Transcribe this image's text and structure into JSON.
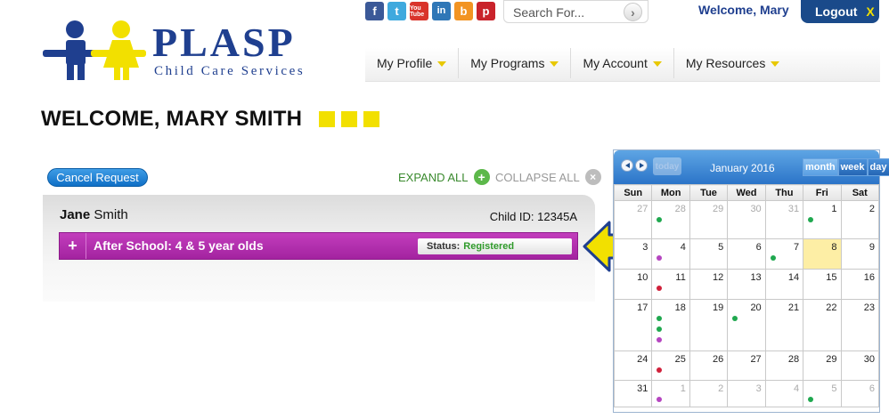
{
  "brand": {
    "name": "PLASP",
    "tagline": "Child Care Services",
    "colors": {
      "navy": "#1f3f8f",
      "yellow": "#f2e000",
      "magenta": "#b02fad"
    }
  },
  "social": [
    {
      "icon": "facebook-icon",
      "glyph": "f"
    },
    {
      "icon": "twitter-icon",
      "glyph": "t"
    },
    {
      "icon": "youtube-icon",
      "glyph": "You Tube"
    },
    {
      "icon": "linkedin-icon",
      "glyph": "in"
    },
    {
      "icon": "blogger-icon",
      "glyph": "b"
    },
    {
      "icon": "pinterest-icon",
      "glyph": "p"
    }
  ],
  "search": {
    "placeholder": "Search For...",
    "button_glyph": "›"
  },
  "user": {
    "welcome": "Welcome, Mary",
    "logout_label": "Logout",
    "logout_x": "X"
  },
  "nav": [
    {
      "id": "my-profile",
      "label": "My Profile"
    },
    {
      "id": "my-programs",
      "label": "My Programs"
    },
    {
      "id": "my-account",
      "label": "My Account"
    },
    {
      "id": "my-resources",
      "label": "My Resources"
    }
  ],
  "page": {
    "title": "WELCOME, MARY SMITH"
  },
  "request": {
    "cancel_label": "Cancel Request",
    "expand_label": "EXPAND ALL",
    "expand_glyph": "+",
    "collapse_label": "COLLAPSE ALL",
    "collapse_glyph": "×",
    "child": {
      "first_name": "Jane",
      "last_name": "Smith",
      "id_label": "Child ID:",
      "id_value": "12345A"
    },
    "program": {
      "plus_glyph": "+",
      "name": "After School: 4 & 5 year olds",
      "status_label": "Status:",
      "status_value": "Registered"
    }
  },
  "calendar": {
    "title": "January 2016",
    "today_label": "today",
    "views": [
      "month",
      "week",
      "day"
    ],
    "active_view": "month",
    "weekdays": [
      "Sun",
      "Mon",
      "Tue",
      "Wed",
      "Thu",
      "Fri",
      "Sat"
    ],
    "dot_colors": {
      "g": "#1fa84f",
      "p": "#b545c0",
      "r": "#d0203a"
    },
    "weeks": [
      [
        {
          "d": "27",
          "other": true
        },
        {
          "d": "28",
          "other": true,
          "dots": [
            "g"
          ]
        },
        {
          "d": "29",
          "other": true
        },
        {
          "d": "30",
          "other": true
        },
        {
          "d": "31",
          "other": true
        },
        {
          "d": "1",
          "dots": [
            "g"
          ]
        },
        {
          "d": "2"
        }
      ],
      [
        {
          "d": "3"
        },
        {
          "d": "4",
          "dots": [
            "p"
          ]
        },
        {
          "d": "5"
        },
        {
          "d": "6"
        },
        {
          "d": "7",
          "dots": [
            "g"
          ]
        },
        {
          "d": "8",
          "today": true
        },
        {
          "d": "9"
        }
      ],
      [
        {
          "d": "10"
        },
        {
          "d": "11",
          "dots": [
            "r"
          ]
        },
        {
          "d": "12"
        },
        {
          "d": "13"
        },
        {
          "d": "14"
        },
        {
          "d": "15"
        },
        {
          "d": "16"
        }
      ],
      [
        {
          "d": "17"
        },
        {
          "d": "18",
          "dots": [
            "g",
            "g",
            "p"
          ]
        },
        {
          "d": "19"
        },
        {
          "d": "20",
          "dots": [
            "g"
          ]
        },
        {
          "d": "21"
        },
        {
          "d": "22"
        },
        {
          "d": "23"
        }
      ],
      [
        {
          "d": "24"
        },
        {
          "d": "25",
          "dots": [
            "r"
          ]
        },
        {
          "d": "26"
        },
        {
          "d": "27"
        },
        {
          "d": "28"
        },
        {
          "d": "29"
        },
        {
          "d": "30"
        }
      ],
      [
        {
          "d": "31"
        },
        {
          "d": "1",
          "other": true,
          "dots": [
            "p"
          ]
        },
        {
          "d": "2",
          "other": true
        },
        {
          "d": "3",
          "other": true
        },
        {
          "d": "4",
          "other": true
        },
        {
          "d": "5",
          "other": true,
          "dots": [
            "g"
          ]
        },
        {
          "d": "6",
          "other": true
        }
      ]
    ]
  }
}
